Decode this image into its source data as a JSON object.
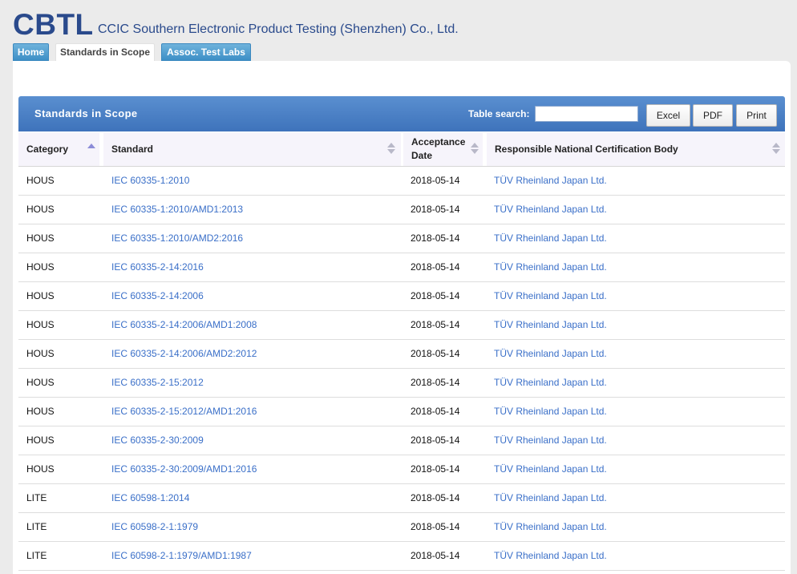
{
  "header": {
    "logo": "CBTL",
    "company": "CCIC Southern Electronic Product Testing (Shenzhen) Co., Ltd."
  },
  "tabs": [
    {
      "label": "Home",
      "state": "inactive"
    },
    {
      "label": "Standards in Scope",
      "state": "active"
    },
    {
      "label": "Assoc. Test Labs",
      "state": "inactive"
    }
  ],
  "panel": {
    "title": "Standards in Scope",
    "search_label": "Table search:",
    "search_value": "",
    "buttons": {
      "excel": "Excel",
      "pdf": "PDF",
      "print": "Print"
    }
  },
  "table": {
    "columns": [
      "Category",
      "Standard",
      "Acceptance Date",
      "Responsible National Certification Body"
    ],
    "sorted_column": "Category",
    "sort_direction": "ascending",
    "rows": [
      [
        "HOUS",
        "IEC 60335-1:2010",
        "2018-05-14",
        "TÜV Rheinland Japan Ltd."
      ],
      [
        "HOUS",
        "IEC 60335-1:2010/AMD1:2013",
        "2018-05-14",
        "TÜV Rheinland Japan Ltd."
      ],
      [
        "HOUS",
        "IEC 60335-1:2010/AMD2:2016",
        "2018-05-14",
        "TÜV Rheinland Japan Ltd."
      ],
      [
        "HOUS",
        "IEC 60335-2-14:2016",
        "2018-05-14",
        "TÜV Rheinland Japan Ltd."
      ],
      [
        "HOUS",
        "IEC 60335-2-14:2006",
        "2018-05-14",
        "TÜV Rheinland Japan Ltd."
      ],
      [
        "HOUS",
        "IEC 60335-2-14:2006/AMD1:2008",
        "2018-05-14",
        "TÜV Rheinland Japan Ltd."
      ],
      [
        "HOUS",
        "IEC 60335-2-14:2006/AMD2:2012",
        "2018-05-14",
        "TÜV Rheinland Japan Ltd."
      ],
      [
        "HOUS",
        "IEC 60335-2-15:2012",
        "2018-05-14",
        "TÜV Rheinland Japan Ltd."
      ],
      [
        "HOUS",
        "IEC 60335-2-15:2012/AMD1:2016",
        "2018-05-14",
        "TÜV Rheinland Japan Ltd."
      ],
      [
        "HOUS",
        "IEC 60335-2-30:2009",
        "2018-05-14",
        "TÜV Rheinland Japan Ltd."
      ],
      [
        "HOUS",
        "IEC 60335-2-30:2009/AMD1:2016",
        "2018-05-14",
        "TÜV Rheinland Japan Ltd."
      ],
      [
        "LITE",
        "IEC 60598-1:2014",
        "2018-05-14",
        "TÜV Rheinland Japan Ltd."
      ],
      [
        "LITE",
        "IEC 60598-2-1:1979",
        "2018-05-14",
        "TÜV Rheinland Japan Ltd."
      ],
      [
        "LITE",
        "IEC 60598-2-1:1979/AMD1:1987",
        "2018-05-14",
        "TÜV Rheinland Japan Ltd."
      ]
    ]
  },
  "colors": {
    "brand": "#2a4a8c",
    "tab_blue": "#3d8fc6",
    "panel_header": "#3e73bb",
    "link": "#3a6fc8"
  },
  "icons": {
    "sort_both": "sort-both-icon",
    "sort_asc": "sort-ascending-icon"
  }
}
